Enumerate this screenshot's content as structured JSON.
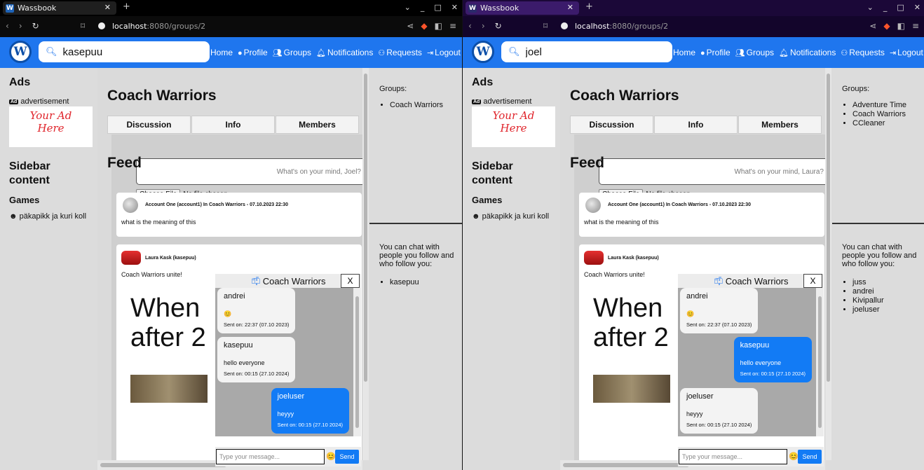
{
  "windows": [
    {
      "tab_title": "Wassbook",
      "url_host": "localhost",
      "url_path": ":8080/groups/2",
      "search_value": "kasepuu",
      "nav": {
        "home": "Home",
        "profile": "Profile",
        "groups": "Groups",
        "notifications": "Notifications",
        "requests": "Requests",
        "logout": "Logout"
      },
      "left": {
        "ads_title": "Ads",
        "ad_label": "advertisement",
        "ad_text": "Your Ad Here",
        "sidebar_title": "Sidebar content",
        "games_title": "Games",
        "game_item": "päkapikk ja kuri koll"
      },
      "main": {
        "group_title": "Coach Warriors",
        "tabs": [
          "Discussion",
          "Info",
          "Members"
        ],
        "post_placeholder": "What's on your mind, Joel?",
        "choose_file": "Choose File",
        "no_file": "No file chosen",
        "feed_title": "Feed",
        "posts": [
          {
            "meta": "Account One (account1) In Coach Warriors - 07.10.2023 22:30",
            "text": "what is the meaning of this"
          },
          {
            "meta": "Laura Kask (kasepuu)",
            "text": "Coach Warriors unite!",
            "big": "When\nafter 2"
          }
        ]
      },
      "right": {
        "groups_label": "Groups:",
        "groups": [
          "Coach Warriors"
        ],
        "chat_info": "You can chat with people you follow and who follow you:",
        "chat_users": [
          "kasepuu"
        ]
      },
      "chat": {
        "title": "Coach Warriors",
        "close": "X",
        "messages": [
          {
            "who": "andrei",
            "text": "😊",
            "ts": "Sent on: 22:37 (07.10 2023)",
            "dir": "in"
          },
          {
            "who": "kasepuu",
            "text": "hello everyone",
            "ts": "Sent on: 00:15 (27.10 2024)",
            "dir": "in"
          },
          {
            "who": "joeluser",
            "text": "heyyy",
            "ts": "Sent on: 00:15 (27.10 2024)",
            "dir": "out"
          }
        ],
        "placeholder": "Type your message...",
        "send": "Send"
      }
    },
    {
      "tab_title": "Wassbook",
      "url_host": "localhost",
      "url_path": ":8080/groups/2",
      "search_value": "joel",
      "nav": {
        "home": "Home",
        "profile": "Profile",
        "groups": "Groups",
        "notifications": "Notifications",
        "requests": "Requests",
        "logout": "Logout"
      },
      "left": {
        "ads_title": "Ads",
        "ad_label": "advertisement",
        "ad_text": "Your Ad Here",
        "sidebar_title": "Sidebar content",
        "games_title": "Games",
        "game_item": "päkapikk ja kuri koll"
      },
      "main": {
        "group_title": "Coach Warriors",
        "tabs": [
          "Discussion",
          "Info",
          "Members"
        ],
        "post_placeholder": "What's on your mind, Laura?",
        "choose_file": "Choose File",
        "no_file": "No file chosen",
        "feed_title": "Feed",
        "posts": [
          {
            "meta": "Account One (account1) In Coach Warriors - 07.10.2023 22:30",
            "text": "what is the meaning of this"
          },
          {
            "meta": "Laura Kask (kasepuu)",
            "text": "Coach Warriors unite!",
            "big": "When\nafter 2"
          }
        ]
      },
      "right": {
        "groups_label": "Groups:",
        "groups": [
          "Adventure Time",
          "Coach Warriors",
          "CCleaner"
        ],
        "chat_info": "You can chat with people you follow and who follow you:",
        "chat_users": [
          "juss",
          "andrei",
          "Kivipallur",
          "joeluser"
        ]
      },
      "chat": {
        "title": "Coach Warriors",
        "close": "X",
        "messages": [
          {
            "who": "andrei",
            "text": "😊",
            "ts": "Sent on: 22:37 (07.10 2023)",
            "dir": "in"
          },
          {
            "who": "kasepuu",
            "text": "hello everyone",
            "ts": "Sent on: 00:15 (27.10 2024)",
            "dir": "out"
          },
          {
            "who": "joeluser",
            "text": "heyyy",
            "ts": "Sent on: 00:15 (27.10 2024)",
            "dir": "in"
          }
        ],
        "placeholder": "Type your message...",
        "send": "Send"
      }
    }
  ]
}
